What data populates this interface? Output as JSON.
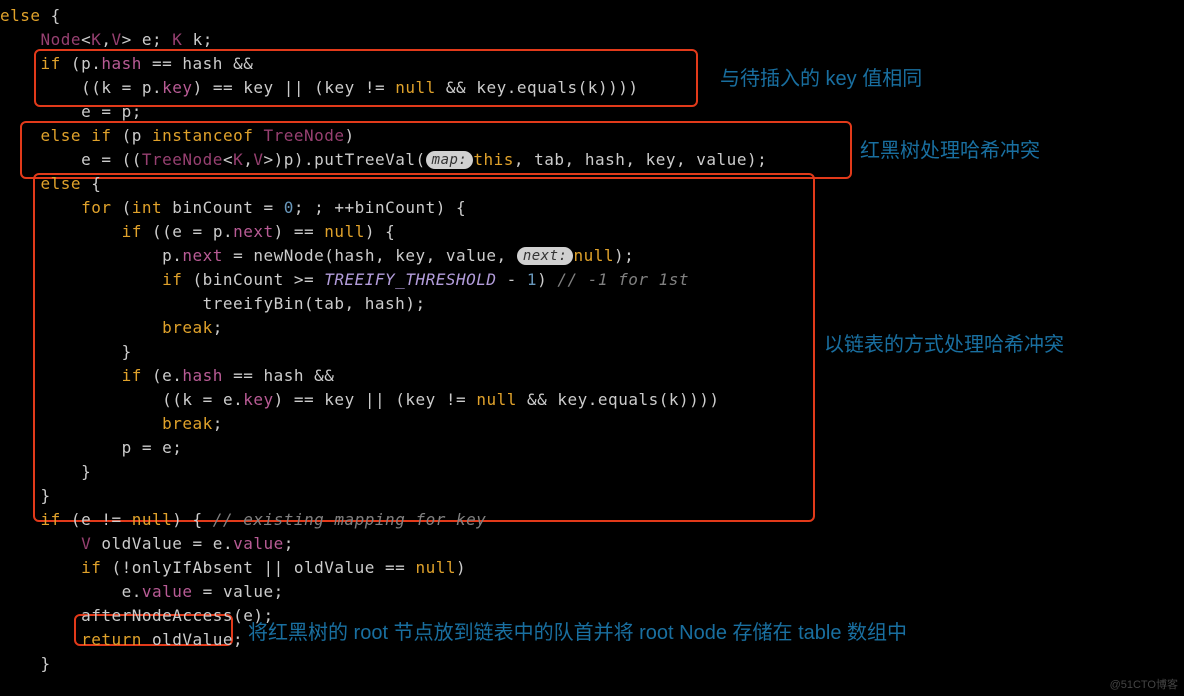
{
  "code": {
    "l1": {
      "kw_else": "else",
      "brace": "{"
    },
    "l2": {
      "type1": "Node",
      "lt": "<",
      "type2": "K",
      "comma": ",",
      "type3": "V",
      "gt": ">",
      "sp": " e; ",
      "type4": "K",
      "var": " k;"
    },
    "l3": {
      "kw_if": "if",
      "open": " (",
      "p": "p",
      "dot": ".",
      "hash": "hash",
      "eq": " == ",
      "hash2": "hash",
      "and": " &&"
    },
    "l4": {
      "open": "((",
      "k": "k",
      "asg": " = ",
      "p": "p",
      "dot": ".",
      "key": "key",
      "close": ")",
      "eq": " == ",
      "key2": "key",
      "or": " || (",
      "key3": "key",
      "ne": " != ",
      "null": "null",
      "and": " && ",
      "key4": "key",
      "dot2": ".",
      "equals": "equals",
      "open2": "(",
      "k2": "k",
      "close2": "))))"
    },
    "l5": {
      "e": "e",
      "asg": " = ",
      "p": "p",
      "semi": ";"
    },
    "l6": {
      "kw_else": "else if",
      "open": " (",
      "p": "p",
      "sp": " ",
      "inst": "instanceof",
      "sp2": " ",
      "tn": "TreeNode",
      "close": ")"
    },
    "l7": {
      "e": "e",
      "asg": " = ((",
      "tn": "TreeNode",
      "lt": "<",
      "k": "K",
      "comma": ",",
      "v": "V",
      "gt": ">",
      "p": ")p).",
      "ptv": "putTreeVal",
      "open": "(",
      "pill": "map:",
      "this": "this",
      "args": ", tab, hash, key, value);"
    },
    "l8": {
      "kw_else": "else",
      "brace": " {"
    },
    "l9": {
      "kw_for": "for",
      "open": " (",
      "int": "int",
      "var": " binCount = ",
      "zero": "0",
      "mid": "; ; ++binCount) {"
    },
    "l10": {
      "kw_if": "if",
      "open": " ((",
      "e": "e",
      "asg": " = ",
      "p": "p",
      "dot": ".",
      "next": "next",
      "close": ")",
      "eq": " == ",
      "null": "null",
      "end": ") {"
    },
    "l11": {
      "p": "p",
      "dot": ".",
      "next": "next",
      "asg": " = ",
      "newn": "newNode",
      "open": "(hash, key, value, ",
      "pill": "next:",
      "null": "null",
      "close": ");"
    },
    "l12": {
      "kw_if": "if",
      "open": " (binCount >= ",
      "thr": "TREEIFY_THRESHOLD",
      "minus": " - ",
      "one": "1",
      "close": ") ",
      "comment": "// -1 for 1st"
    },
    "l13": {
      "fn": "treeifyBin",
      "args": "(tab, hash);"
    },
    "l14": {
      "kw": "break",
      "semi": ";"
    },
    "l15": {
      "brace": "}"
    },
    "l16": {
      "kw_if": "if",
      "open": " (",
      "e": "e",
      "dot": ".",
      "hash": "hash",
      "eq": " == ",
      "hash2": "hash",
      "and": " &&"
    },
    "l17": {
      "open": "((",
      "k": "k",
      "asg": " = ",
      "e": "e",
      "dot": ".",
      "key": "key",
      "close": ")",
      "eq": " == ",
      "key2": "key",
      "or": " || (",
      "key3": "key",
      "ne": " != ",
      "null": "null",
      "and": " && ",
      "key4": "key",
      "dot2": ".",
      "equals": "equals",
      "open2": "(",
      "k2": "k",
      "close2": "))))"
    },
    "l18": {
      "kw": "break",
      "semi": ";"
    },
    "l19": {
      "p": "p",
      "asg": " = ",
      "e": "e",
      "semi": ";"
    },
    "l20": {
      "brace": "}"
    },
    "l21": {
      "brace": "}"
    },
    "l22": {
      "kw_if": "if",
      "open": " (",
      "e": "e",
      "ne": " != ",
      "null": "null",
      "close": ") { ",
      "comment": "// existing mapping for key"
    },
    "l23": {
      "type": "V",
      "var": " oldValue = ",
      "e": "e",
      "dot": ".",
      "value": "value",
      "semi": ";"
    },
    "l24": {
      "kw_if": "if",
      "open": " (!onlyIfAbsent || oldValue == ",
      "null": "null",
      "close": ")"
    },
    "l25": {
      "e": "e",
      "dot": ".",
      "value": "value",
      "asg": " = ",
      "value2": "value;"
    },
    "l26": {
      "fn": "afterNodeAccess",
      "args": "(e);"
    },
    "l27": {
      "kw": "return",
      "var": " oldValue;"
    },
    "l28": {
      "brace": "}"
    }
  },
  "annotations": {
    "a1": "与待插入的 key 值相同",
    "a2": "红黑树处理哈希冲突",
    "a3": "以链表的方式处理哈希冲突",
    "a4": "将红黑树的 root 节点放到链表中的队首并将 root Node 存储在 table 数组中"
  },
  "watermark": "@51CTO博客"
}
